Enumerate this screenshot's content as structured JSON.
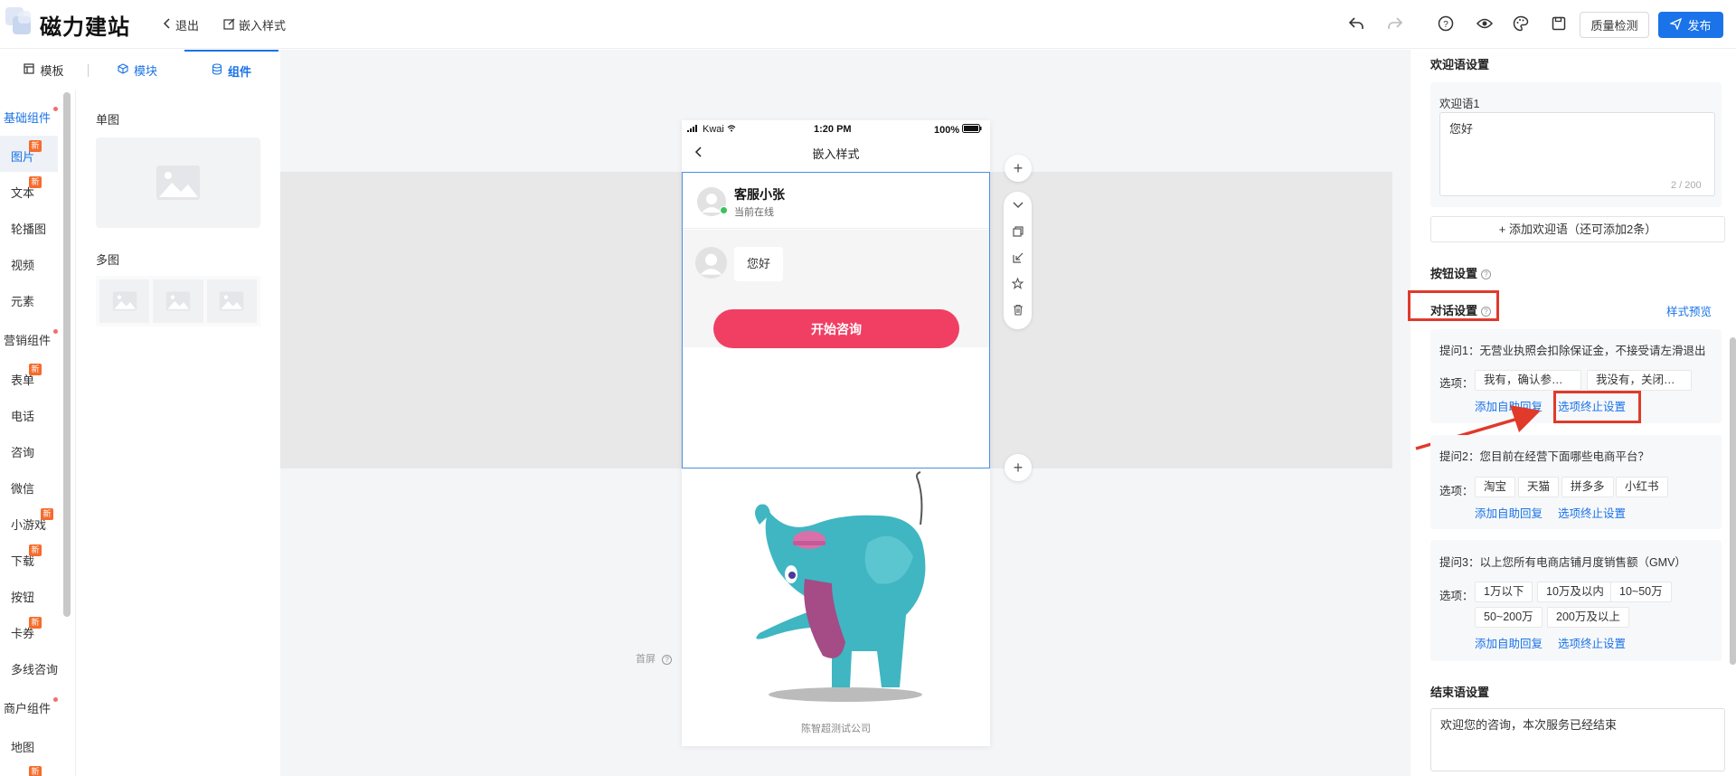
{
  "app": {
    "logo_text": "磁力建站",
    "exit_label": "退出",
    "page_name": "嵌入样式",
    "quality_check_label": "质量检测",
    "publish_label": "发布"
  },
  "left_tabs": [
    {
      "label": "模板"
    },
    {
      "label": "模块"
    },
    {
      "label": "组件"
    }
  ],
  "rail": {
    "groups": [
      "基础组件",
      "营销组件",
      "商户组件"
    ],
    "basic_items": [
      "图片",
      "文本",
      "轮播图",
      "视频",
      "元素"
    ],
    "marketing_items": [
      "表单",
      "电话",
      "咨询",
      "微信",
      "小游戏",
      "下载",
      "按钮",
      "卡券",
      "多线咨询"
    ],
    "merchant_items": [
      "地图"
    ],
    "new_badge": "新"
  },
  "components": {
    "single_title": "单图",
    "multi_title": "多图"
  },
  "phone": {
    "carrier": "Kwai",
    "time": "1:20 PM",
    "battery": "100%",
    "nav_title": "嵌入样式",
    "agent_name": "客服小张",
    "agent_status": "当前在线",
    "greeting": "您好",
    "cta_label": "开始咨询",
    "first_screen": "首屏",
    "company": "陈智超测试公司"
  },
  "right_panel": {
    "welcome_title": "欢迎语设置",
    "welcome_label": "欢迎语1",
    "welcome_value": "您好",
    "welcome_counter": "2 / 200",
    "add_welcome": "+ 添加欢迎语（还可添加2条）",
    "button_settings": "按钮设置",
    "dialog_settings": "对话设置",
    "style_preview": "样式预览",
    "options_label": "选项：",
    "add_auto_reply": "添加自助回复",
    "option_stop": "选项终止设置",
    "questions": [
      {
        "text": "提问1：无营业执照会扣除保证金，不接受请左滑退出",
        "options": [
          "我有，确认参…",
          "我没有，关闭…"
        ]
      },
      {
        "text": "提问2：您目前在经营下面哪些电商平台？",
        "options": [
          "淘宝",
          "天猫",
          "拼多多",
          "小红书"
        ]
      },
      {
        "text": "提问3：以上您所有电商店铺月度销售额（GMV）",
        "options": [
          "1万以下",
          "10万及以内",
          "10~50万",
          "50~200万",
          "200万及以上"
        ]
      }
    ],
    "end_title": "结束语设置",
    "end_value": "欢迎您的咨询，本次服务已经结束"
  },
  "colors": {
    "accent": "#1a73e8",
    "cta": "#f03f63",
    "annotation_red": "#e03a2b",
    "new_badge": "#f56c2c"
  }
}
